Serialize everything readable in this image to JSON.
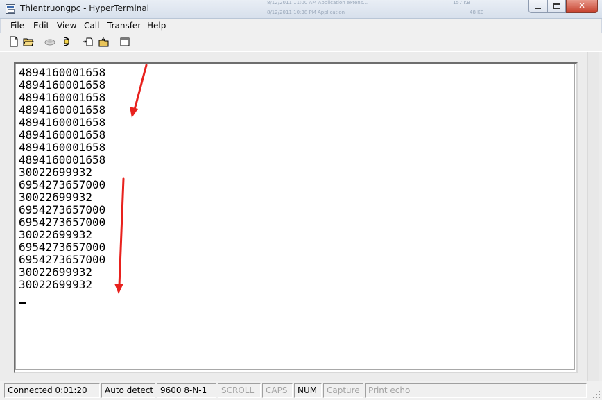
{
  "window": {
    "title": "Thientruongpc - HyperTerminal",
    "background_ghost_text": [
      "8/12/2011 11:00 AM   Application extens...   ",
      "8/12/2011 10:38 PM   Application",
      "157 KB",
      "48 KB"
    ]
  },
  "menu": [
    "File",
    "Edit",
    "View",
    "Call",
    "Transfer",
    "Help"
  ],
  "toolbar_icons": [
    "new-file-icon",
    "open-folder-icon",
    "disconnect-phone-icon",
    "call-phone-icon",
    "send-file-icon",
    "receive-file-icon",
    "properties-icon"
  ],
  "terminal_lines": [
    "4894160001658",
    "4894160001658",
    "4894160001658",
    "4894160001658",
    "4894160001658",
    "4894160001658",
    "4894160001658",
    "4894160001658",
    "30022699932",
    "6954273657000",
    "30022699932",
    "6954273657000",
    "6954273657000",
    "30022699932",
    "6954273657000",
    "6954273657000",
    "30022699932",
    "30022699932"
  ],
  "status": {
    "connected": "Connected 0:01:20",
    "detect": "Auto detect",
    "settings": "9600 8-N-1",
    "scroll": "SCROLL",
    "caps": "CAPS",
    "num": "NUM",
    "capture": "Capture",
    "print_echo": "Print echo"
  },
  "colors": {
    "annotation_arrow": "#e8211d",
    "status_dim": "#a3a3a3"
  }
}
